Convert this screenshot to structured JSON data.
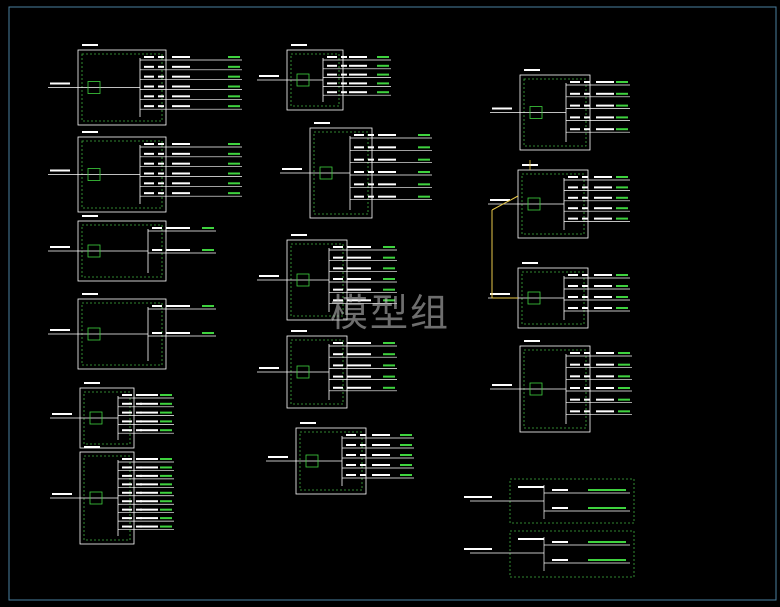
{
  "watermark": "模型组",
  "colors": {
    "background": "#000000",
    "border": "#4a7fa0",
    "box": "#ffffff",
    "frame": "#3fae3f",
    "wire": "#ffffff",
    "bus": "#e8c84a",
    "accent_green": "#3fd23f",
    "text": "#ffffff"
  }
}
